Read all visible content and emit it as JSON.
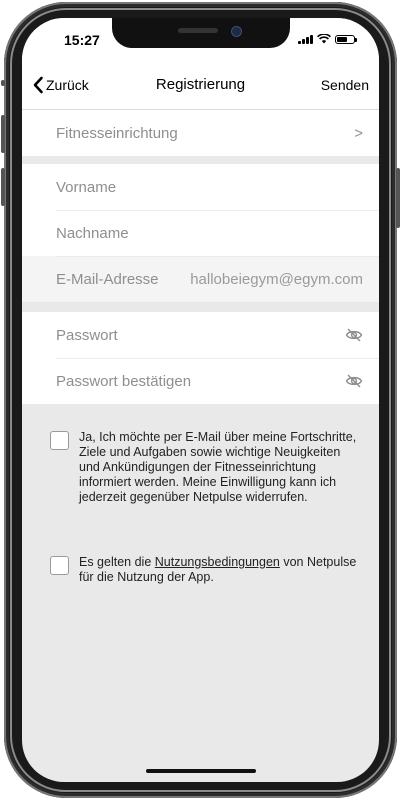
{
  "status_bar": {
    "time": "15:27",
    "battery_level": 0.6
  },
  "nav": {
    "back_label": "Zurück",
    "title": "Registrierung",
    "send_label": "Senden"
  },
  "form": {
    "facility_label": "Fitnesseinrichtung",
    "first_name_placeholder": "Vorname",
    "last_name_placeholder": "Nachname",
    "email_label": "E-Mail-Adresse",
    "email_value": "hallobeiegym@egym.com",
    "password_placeholder": "Passwort",
    "password_confirm_placeholder": "Passwort bestätigen"
  },
  "consents": {
    "email_consent_text": "Ja, Ich möchte per E-Mail über meine Fortschritte, Ziele und Aufgaben sowie wichtige Neuigkeiten und Ankündigungen der Fitnesseinrichtung informiert werden. Meine Einwilligung kann ich jederzeit gegenüber Netpulse widerrufen.",
    "terms_prefix": "Es gelten die ",
    "terms_link": "Nutzungsbedingungen",
    "terms_suffix": " von Netpulse für die Nutzung der App."
  },
  "icons": {
    "back": "chevron-left-icon",
    "facility": "chevron-right-icon",
    "password_visibility": "eye-slash-icon"
  },
  "colors": {
    "accent": "#000000",
    "placeholder": "#8e8e93",
    "background": "#e9e9e9"
  }
}
